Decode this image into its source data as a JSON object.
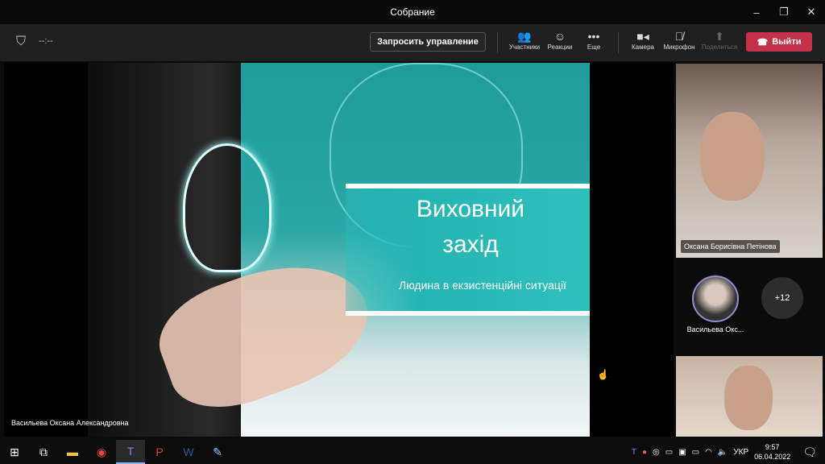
{
  "window": {
    "title": "Собрание",
    "minimize": "–",
    "restore": "❐",
    "close": "✕"
  },
  "toolbar": {
    "timer": "--:--",
    "request_control": "Запросить управление",
    "buttons": [
      {
        "label": "Участники",
        "icon": "people-icon"
      },
      {
        "label": "Реакции",
        "icon": "reactions-icon"
      },
      {
        "label": "Еще",
        "icon": "more-icon"
      },
      {
        "label": "Камера",
        "icon": "camera-icon"
      },
      {
        "label": "Микрофон",
        "icon": "mic-off-icon"
      },
      {
        "label": "Поделиться",
        "icon": "share-icon"
      }
    ],
    "leave": "Выйти"
  },
  "slide": {
    "title1": "Виховний",
    "title2": "захід",
    "subtitle": "Людина в екзистенційні ситуації"
  },
  "presenter_name": "Васильева Оксана Александровна",
  "participants": [
    {
      "name": "Оксана Борисівна Петінова"
    },
    {
      "name": "Васильева Окс..."
    }
  ],
  "overflow_count": "+12",
  "taskbar": {
    "lang": "УКР",
    "time": "9:57",
    "date": "06.04.2022"
  }
}
